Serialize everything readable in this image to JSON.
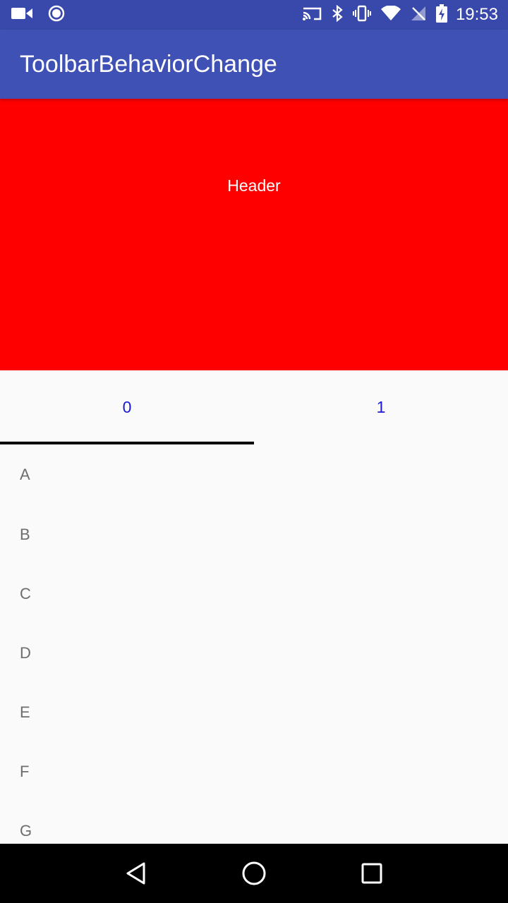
{
  "status_bar": {
    "time": "19:53",
    "left_icons": [
      "video-camera-icon",
      "record-icon"
    ],
    "right_icons": [
      "cast-icon",
      "bluetooth-icon",
      "vibrate-icon",
      "wifi-icon",
      "no-signal-icon",
      "battery-charging-icon"
    ]
  },
  "toolbar": {
    "title": "ToolbarBehaviorChange"
  },
  "header": {
    "label": "Header"
  },
  "tabs": [
    {
      "label": "0",
      "selected": true
    },
    {
      "label": "1",
      "selected": false
    }
  ],
  "list": {
    "items": [
      "A",
      "B",
      "C",
      "D",
      "E",
      "F",
      "G"
    ]
  },
  "nav_bar": {
    "buttons": [
      "back-icon",
      "home-icon",
      "recents-icon"
    ]
  },
  "colors": {
    "status_bar": "#3949ab",
    "toolbar": "#3f51b5",
    "header": "#ff0000",
    "tab_text": "#1a1ad6",
    "tab_indicator": "#000000",
    "list_text": "#6d6d6d"
  }
}
